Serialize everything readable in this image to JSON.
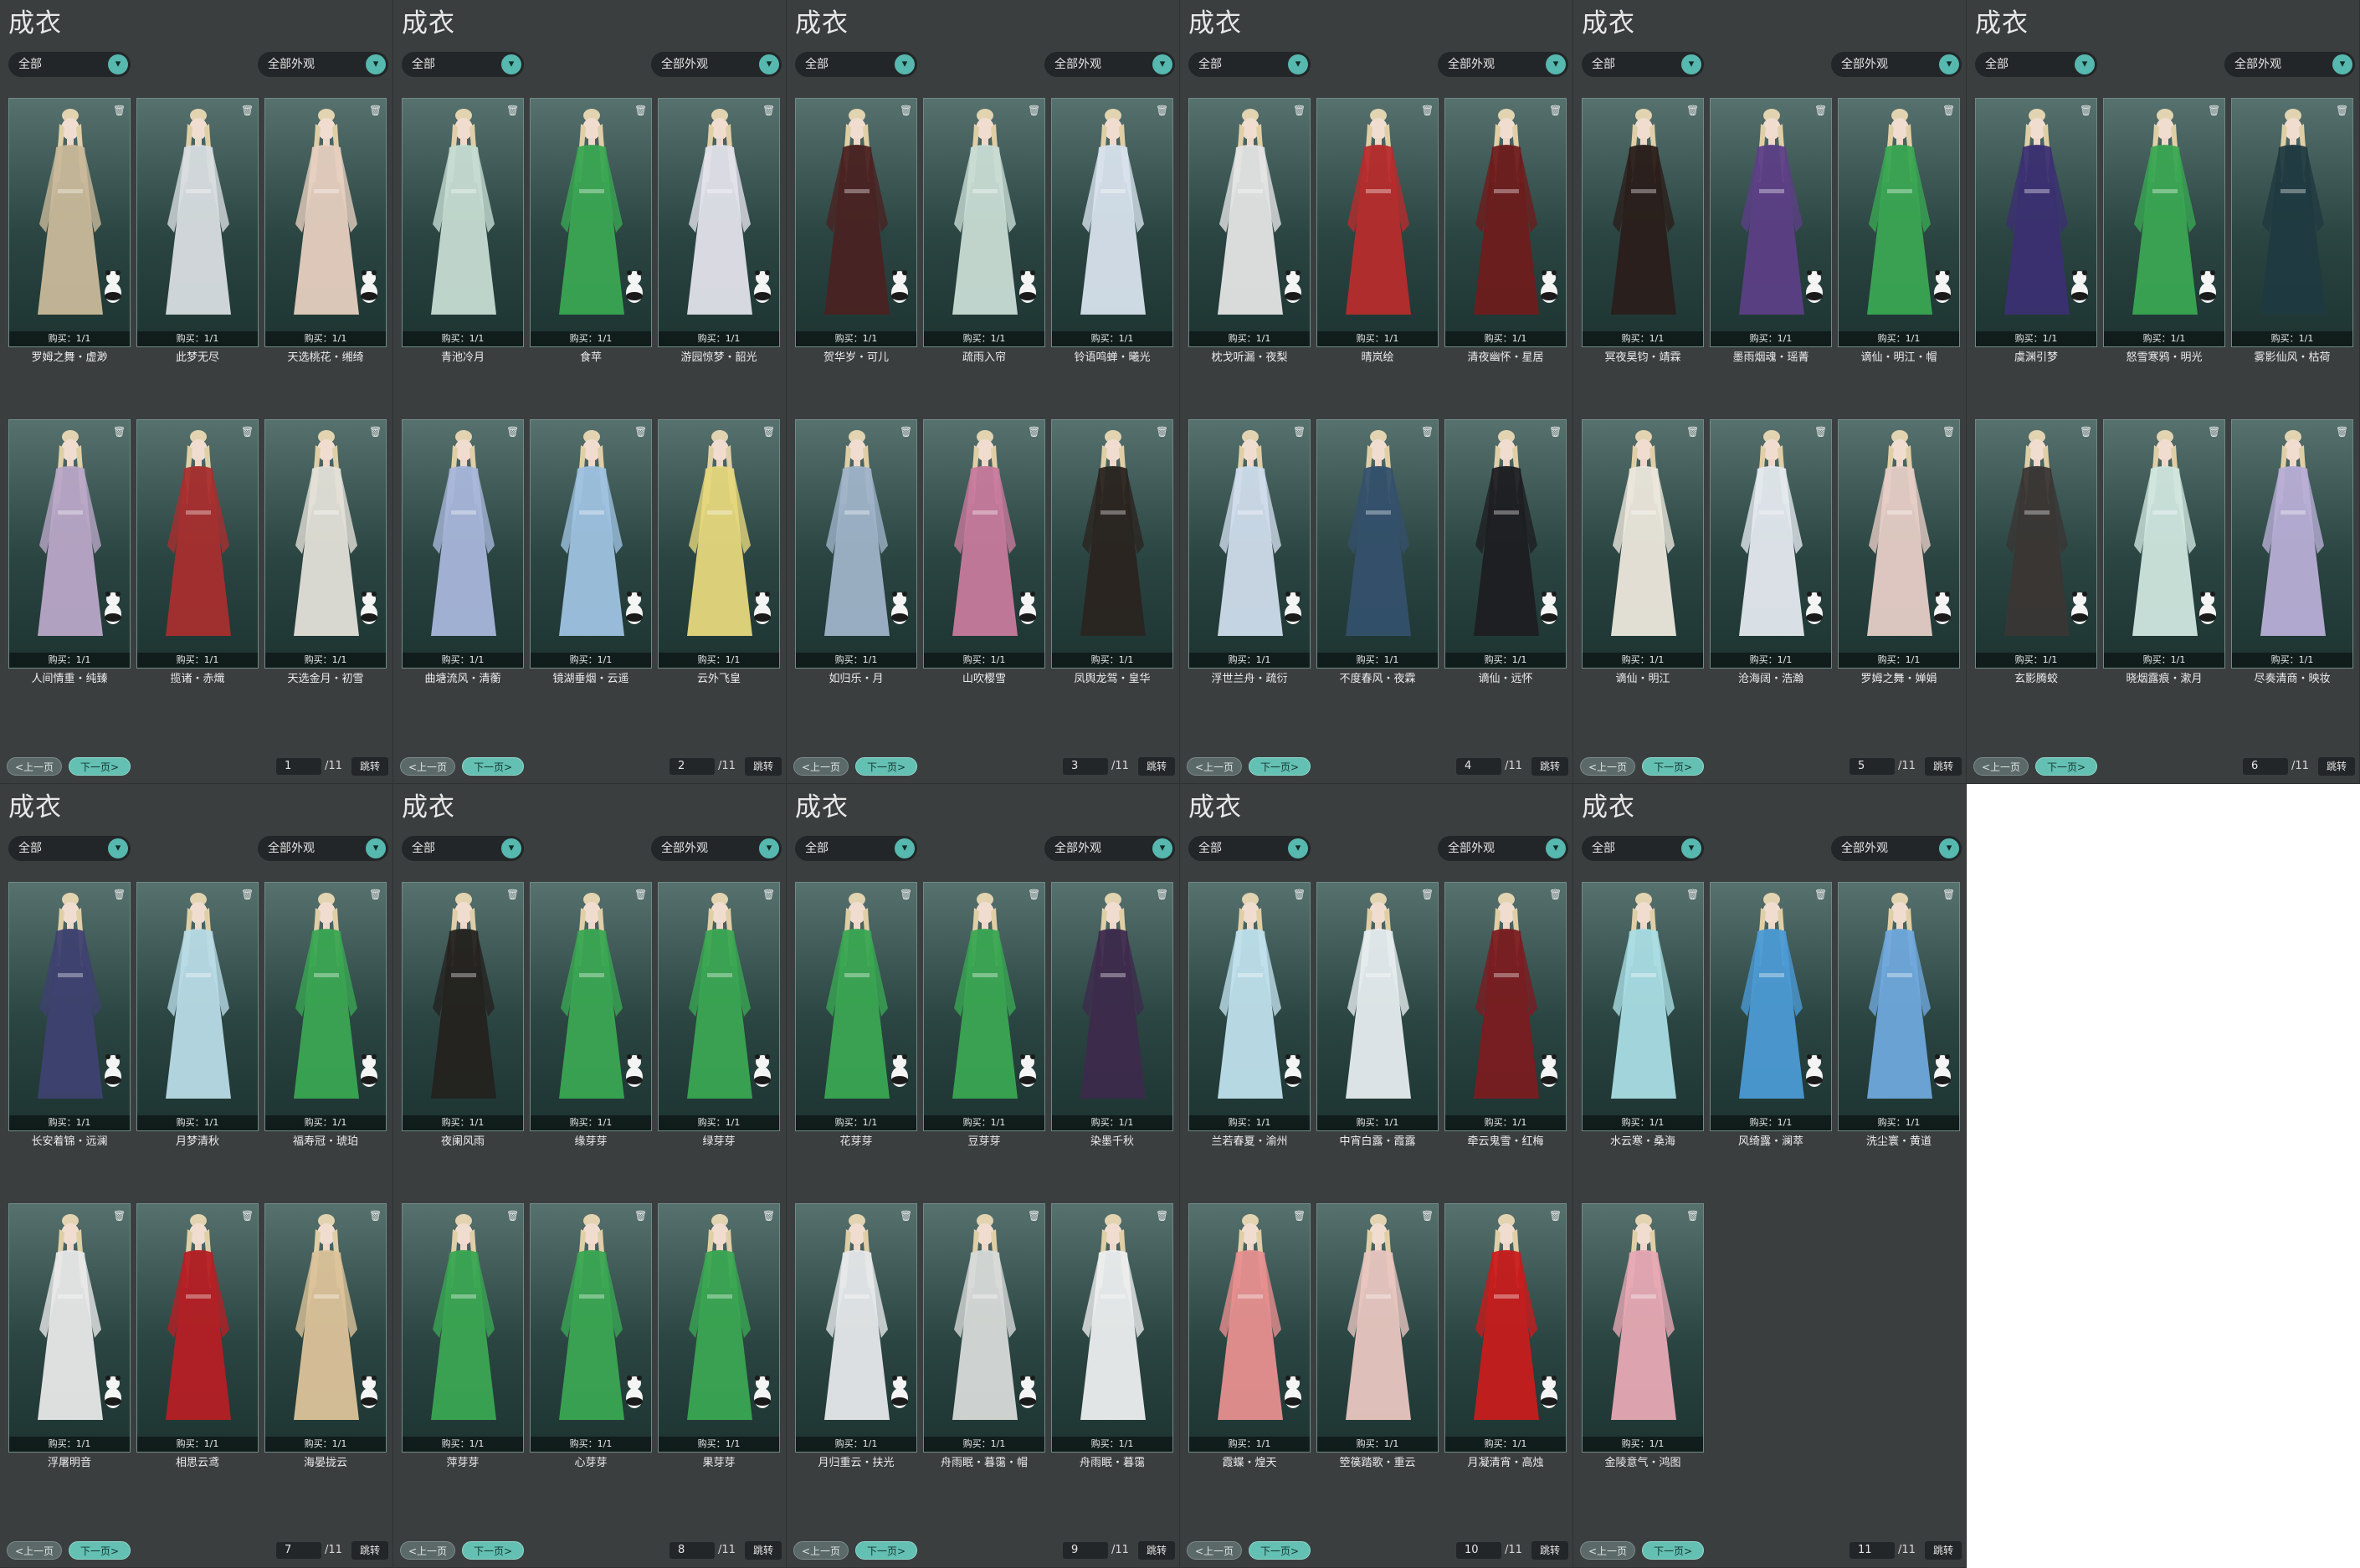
{
  "colors": {
    "panel_bg": "#3b3e3f",
    "accent": "#56b8ae",
    "card_top": "#56716e",
    "card_bottom": "#1d3431",
    "next_button": "#64c0b2",
    "prev_button": "#5b6a68"
  },
  "icons": {
    "dropdown": "chevron-down-icon",
    "delete": "trash-icon",
    "prev": "arrow-left-icon",
    "next": "arrow-right-icon"
  },
  "common": {
    "title": "成衣",
    "filter_left": "全部",
    "filter_right": "全部外观",
    "prev_label": "<上一页",
    "next_label": "下一页>",
    "jump_label": "跳转",
    "buy_label": "购买：1/1"
  },
  "panels": [
    {
      "page": "1",
      "total": "/11",
      "items": [
        {
          "name": "罗姆之舞・虚渺",
          "outfit": "#c9b99a"
        },
        {
          "name": "此梦无尽",
          "outfit": "#d8dde0"
        },
        {
          "name": "天选桃花・缃绮",
          "outfit": "#e6cfbf"
        },
        {
          "name": "人间情重・纯臻",
          "outfit": "#b9a7c7"
        },
        {
          "name": "揽诸・赤熾",
          "outfit": "#a82e2e"
        },
        {
          "name": "天选金月・初雪",
          "outfit": "#e3e0d8"
        }
      ]
    },
    {
      "page": "2",
      "total": "/11",
      "items": [
        {
          "name": "青池冷月",
          "outfit": "#c6dcd2"
        },
        {
          "name": "食苹",
          "outfit": "#3aa652"
        },
        {
          "name": "游园惊梦・韶光",
          "outfit": "#e2e2ea"
        },
        {
          "name": "曲塘流风・清蘅",
          "outfit": "#a8b6da"
        },
        {
          "name": "镜湖垂烟・云遥",
          "outfit": "#9ec2e0"
        },
        {
          "name": "云外飞皇",
          "outfit": "#e6d77d"
        }
      ]
    },
    {
      "page": "3",
      "total": "/11",
      "items": [
        {
          "name": "贺华岁・可儿",
          "outfit": "#4a2222"
        },
        {
          "name": "疏雨入帘",
          "outfit": "#c8dcd4"
        },
        {
          "name": "铃语鸣蝉・曦光",
          "outfit": "#d7e2ec"
        },
        {
          "name": "如归乐・月",
          "outfit": "#9fb3c8"
        },
        {
          "name": "山吹樱雪",
          "outfit": "#c77a9c"
        },
        {
          "name": "凤舆龙驾・皇华",
          "outfit": "#2a2420"
        }
      ]
    },
    {
      "page": "4",
      "total": "/11",
      "items": [
        {
          "name": "枕戈听漏・夜梨",
          "outfit": "#e4e4e4"
        },
        {
          "name": "晴岚绘",
          "outfit": "#b72c2c"
        },
        {
          "name": "清夜幽怀・星居",
          "outfit": "#6e1c1c"
        },
        {
          "name": "浮世兰舟・疏衍",
          "outfit": "#cfdceb"
        },
        {
          "name": "不度春风・夜霖",
          "outfit": "#34506c"
        },
        {
          "name": "谪仙・远怀",
          "outfit": "#1e1e22"
        }
      ]
    },
    {
      "page": "5",
      "total": "/11",
      "items": [
        {
          "name": "冥夜昊钧・靖霖",
          "outfit": "#2a1e1a"
        },
        {
          "name": "墨雨烟魂・瑶菁",
          "outfit": "#5c3f86"
        },
        {
          "name": "谪仙・明江・帽",
          "outfit": "#3aa652"
        },
        {
          "name": "谪仙・明江",
          "outfit": "#ece7dc"
        },
        {
          "name": "沧海阔・浩瀚",
          "outfit": "#e4e9ee"
        },
        {
          "name": "罗姆之舞・婵娟",
          "outfit": "#e6cdc6"
        }
      ]
    },
    {
      "page": "6",
      "total": "/11",
      "items": [
        {
          "name": "虞渊引梦",
          "outfit": "#3b2f72"
        },
        {
          "name": "怒雪寒鸦・明光",
          "outfit": "#3aa652"
        },
        {
          "name": "雾影仙风・枯荷",
          "outfit": "#1f3a40"
        },
        {
          "name": "玄影腾蛟",
          "outfit": "#3a3634"
        },
        {
          "name": "晓烟露痕・漱月",
          "outfit": "#cfe6de"
        },
        {
          "name": "尽奏清商・映妆",
          "outfit": "#b8aed6"
        }
      ]
    },
    {
      "page": "7",
      "total": "/11",
      "items": [
        {
          "name": "长安着锦・远澜",
          "outfit": "#3e4170"
        },
        {
          "name": "月梦清秋",
          "outfit": "#b8dbe6"
        },
        {
          "name": "福寿冠・琥珀",
          "outfit": "#3aa652"
        },
        {
          "name": "浮屠明音",
          "outfit": "#e8e8e8"
        },
        {
          "name": "相思云鸢",
          "outfit": "#b51f24"
        },
        {
          "name": "海晏拢云",
          "outfit": "#dcc39a"
        }
      ]
    },
    {
      "page": "8",
      "total": "/11",
      "items": [
        {
          "name": "夜阑风雨",
          "outfit": "#24221f"
        },
        {
          "name": "缘芽芽",
          "outfit": "#3aa652"
        },
        {
          "name": "绿芽芽",
          "outfit": "#3aa652"
        },
        {
          "name": "萍芽芽",
          "outfit": "#3aa652"
        },
        {
          "name": "心芽芽",
          "outfit": "#3aa652"
        },
        {
          "name": "果芽芽",
          "outfit": "#3aa652"
        }
      ]
    },
    {
      "page": "9",
      "total": "/11",
      "items": [
        {
          "name": "花芽芽",
          "outfit": "#3aa652"
        },
        {
          "name": "豆芽芽",
          "outfit": "#3aa652"
        },
        {
          "name": "染墨千秋",
          "outfit": "#3d2a4c"
        },
        {
          "name": "月归重云・扶光",
          "outfit": "#e6e8ea"
        },
        {
          "name": "舟雨眠・暮霭・帽",
          "outfit": "#d7dad8"
        },
        {
          "name": "舟雨眠・暮霭",
          "outfit": "#eceeee"
        }
      ]
    },
    {
      "page": "10",
      "total": "/11",
      "items": [
        {
          "name": "兰若春夏・渝州",
          "outfit": "#bfe0ec"
        },
        {
          "name": "中宵白露・霞露",
          "outfit": "#e6ecef"
        },
        {
          "name": "牵云鬼雪・红梅",
          "outfit": "#7a1c20"
        },
        {
          "name": "霞蝶・煌天",
          "outfit": "#e78f8f"
        },
        {
          "name": "箜篌踏歌・重云",
          "outfit": "#e9c6c0"
        },
        {
          "name": "月凝清宵・高烛",
          "outfit": "#c71c1c"
        }
      ]
    },
    {
      "page": "11",
      "total": "/11",
      "items": [
        {
          "name": "水云寒・桑海",
          "outfit": "#a9dde4"
        },
        {
          "name": "风绮露・澜萃",
          "outfit": "#4b9ad4"
        },
        {
          "name": "洗尘寰・黄道",
          "outfit": "#6fa8dc"
        },
        {
          "name": "金陵意气・鸿图",
          "outfit": "#e7a9b4"
        }
      ]
    }
  ]
}
